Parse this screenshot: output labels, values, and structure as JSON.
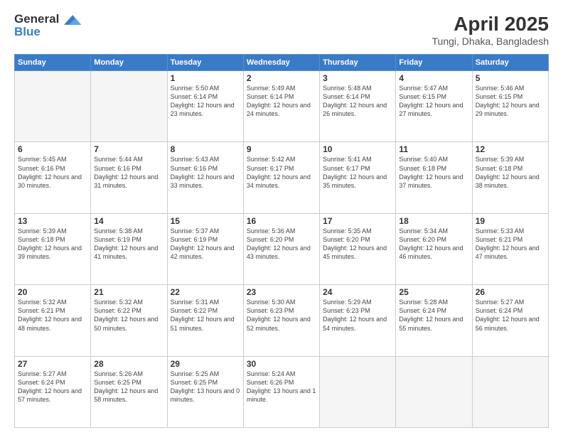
{
  "header": {
    "logo_line1": "General",
    "logo_line2": "Blue",
    "month_year": "April 2025",
    "location": "Tungi, Dhaka, Bangladesh"
  },
  "days_of_week": [
    "Sunday",
    "Monday",
    "Tuesday",
    "Wednesday",
    "Thursday",
    "Friday",
    "Saturday"
  ],
  "weeks": [
    [
      {
        "day": "",
        "info": ""
      },
      {
        "day": "",
        "info": ""
      },
      {
        "day": "1",
        "info": "Sunrise: 5:50 AM\nSunset: 6:14 PM\nDaylight: 12 hours and 23 minutes."
      },
      {
        "day": "2",
        "info": "Sunrise: 5:49 AM\nSunset: 6:14 PM\nDaylight: 12 hours and 24 minutes."
      },
      {
        "day": "3",
        "info": "Sunrise: 5:48 AM\nSunset: 6:14 PM\nDaylight: 12 hours and 26 minutes."
      },
      {
        "day": "4",
        "info": "Sunrise: 5:47 AM\nSunset: 6:15 PM\nDaylight: 12 hours and 27 minutes."
      },
      {
        "day": "5",
        "info": "Sunrise: 5:46 AM\nSunset: 6:15 PM\nDaylight: 12 hours and 29 minutes."
      }
    ],
    [
      {
        "day": "6",
        "info": "Sunrise: 5:45 AM\nSunset: 6:16 PM\nDaylight: 12 hours and 30 minutes."
      },
      {
        "day": "7",
        "info": "Sunrise: 5:44 AM\nSunset: 6:16 PM\nDaylight: 12 hours and 31 minutes."
      },
      {
        "day": "8",
        "info": "Sunrise: 5:43 AM\nSunset: 6:16 PM\nDaylight: 12 hours and 33 minutes."
      },
      {
        "day": "9",
        "info": "Sunrise: 5:42 AM\nSunset: 6:17 PM\nDaylight: 12 hours and 34 minutes."
      },
      {
        "day": "10",
        "info": "Sunrise: 5:41 AM\nSunset: 6:17 PM\nDaylight: 12 hours and 35 minutes."
      },
      {
        "day": "11",
        "info": "Sunrise: 5:40 AM\nSunset: 6:18 PM\nDaylight: 12 hours and 37 minutes."
      },
      {
        "day": "12",
        "info": "Sunrise: 5:39 AM\nSunset: 6:18 PM\nDaylight: 12 hours and 38 minutes."
      }
    ],
    [
      {
        "day": "13",
        "info": "Sunrise: 5:39 AM\nSunset: 6:18 PM\nDaylight: 12 hours and 39 minutes."
      },
      {
        "day": "14",
        "info": "Sunrise: 5:38 AM\nSunset: 6:19 PM\nDaylight: 12 hours and 41 minutes."
      },
      {
        "day": "15",
        "info": "Sunrise: 5:37 AM\nSunset: 6:19 PM\nDaylight: 12 hours and 42 minutes."
      },
      {
        "day": "16",
        "info": "Sunrise: 5:36 AM\nSunset: 6:20 PM\nDaylight: 12 hours and 43 minutes."
      },
      {
        "day": "17",
        "info": "Sunrise: 5:35 AM\nSunset: 6:20 PM\nDaylight: 12 hours and 45 minutes."
      },
      {
        "day": "18",
        "info": "Sunrise: 5:34 AM\nSunset: 6:20 PM\nDaylight: 12 hours and 46 minutes."
      },
      {
        "day": "19",
        "info": "Sunrise: 5:33 AM\nSunset: 6:21 PM\nDaylight: 12 hours and 47 minutes."
      }
    ],
    [
      {
        "day": "20",
        "info": "Sunrise: 5:32 AM\nSunset: 6:21 PM\nDaylight: 12 hours and 48 minutes."
      },
      {
        "day": "21",
        "info": "Sunrise: 5:32 AM\nSunset: 6:22 PM\nDaylight: 12 hours and 50 minutes."
      },
      {
        "day": "22",
        "info": "Sunrise: 5:31 AM\nSunset: 6:22 PM\nDaylight: 12 hours and 51 minutes."
      },
      {
        "day": "23",
        "info": "Sunrise: 5:30 AM\nSunset: 6:23 PM\nDaylight: 12 hours and 52 minutes."
      },
      {
        "day": "24",
        "info": "Sunrise: 5:29 AM\nSunset: 6:23 PM\nDaylight: 12 hours and 54 minutes."
      },
      {
        "day": "25",
        "info": "Sunrise: 5:28 AM\nSunset: 6:24 PM\nDaylight: 12 hours and 55 minutes."
      },
      {
        "day": "26",
        "info": "Sunrise: 5:27 AM\nSunset: 6:24 PM\nDaylight: 12 hours and 56 minutes."
      }
    ],
    [
      {
        "day": "27",
        "info": "Sunrise: 5:27 AM\nSunset: 6:24 PM\nDaylight: 12 hours and 57 minutes."
      },
      {
        "day": "28",
        "info": "Sunrise: 5:26 AM\nSunset: 6:25 PM\nDaylight: 12 hours and 58 minutes."
      },
      {
        "day": "29",
        "info": "Sunrise: 5:25 AM\nSunset: 6:25 PM\nDaylight: 13 hours and 0 minutes."
      },
      {
        "day": "30",
        "info": "Sunrise: 5:24 AM\nSunset: 6:26 PM\nDaylight: 13 hours and 1 minute."
      },
      {
        "day": "",
        "info": ""
      },
      {
        "day": "",
        "info": ""
      },
      {
        "day": "",
        "info": ""
      }
    ]
  ]
}
